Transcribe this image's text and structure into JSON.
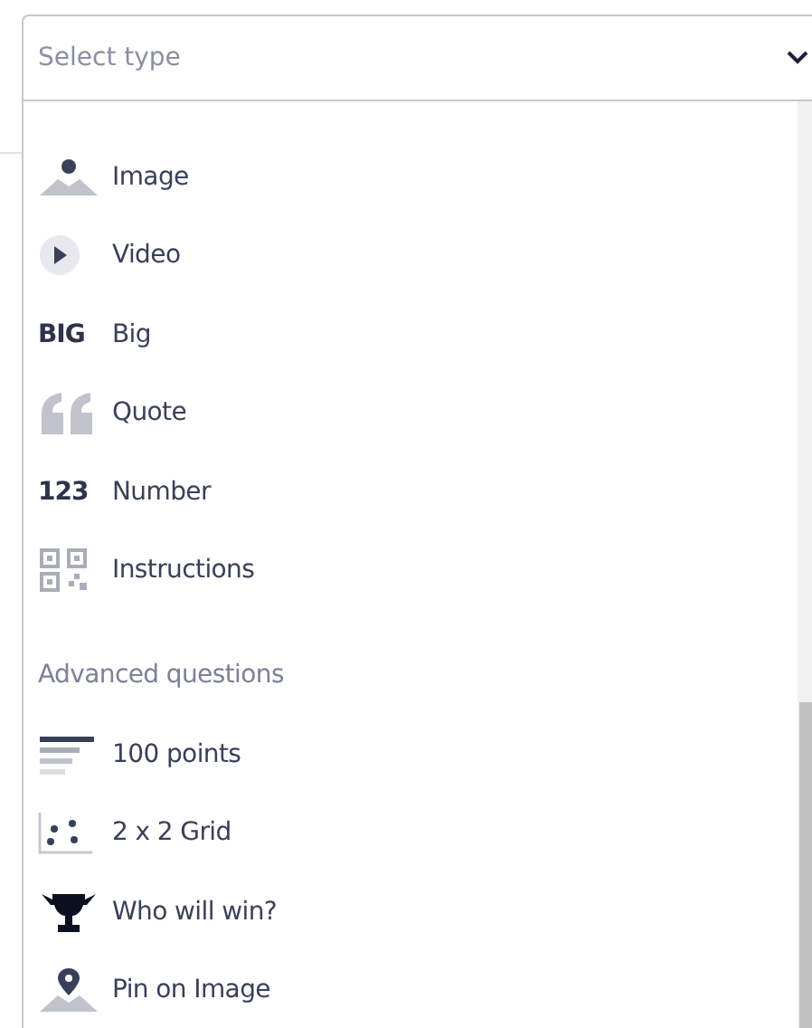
{
  "select": {
    "placeholder": "Select type",
    "expanded": true
  },
  "items": [
    {
      "kind": "image",
      "label": "Image"
    },
    {
      "kind": "video",
      "label": "Video"
    },
    {
      "kind": "big",
      "icon_text": "BIG",
      "label": "Big"
    },
    {
      "kind": "quote",
      "label": "Quote"
    },
    {
      "kind": "number",
      "icon_text": "123",
      "label": "Number"
    },
    {
      "kind": "instructions",
      "label": "Instructions"
    }
  ],
  "advanced": {
    "heading": "Advanced questions",
    "items": [
      {
        "kind": "points",
        "label": "100 points"
      },
      {
        "kind": "grid",
        "label": "2 x 2 Grid"
      },
      {
        "kind": "trophy",
        "label": "Who will win?"
      },
      {
        "kind": "pin",
        "label": "Pin on Image"
      }
    ]
  }
}
